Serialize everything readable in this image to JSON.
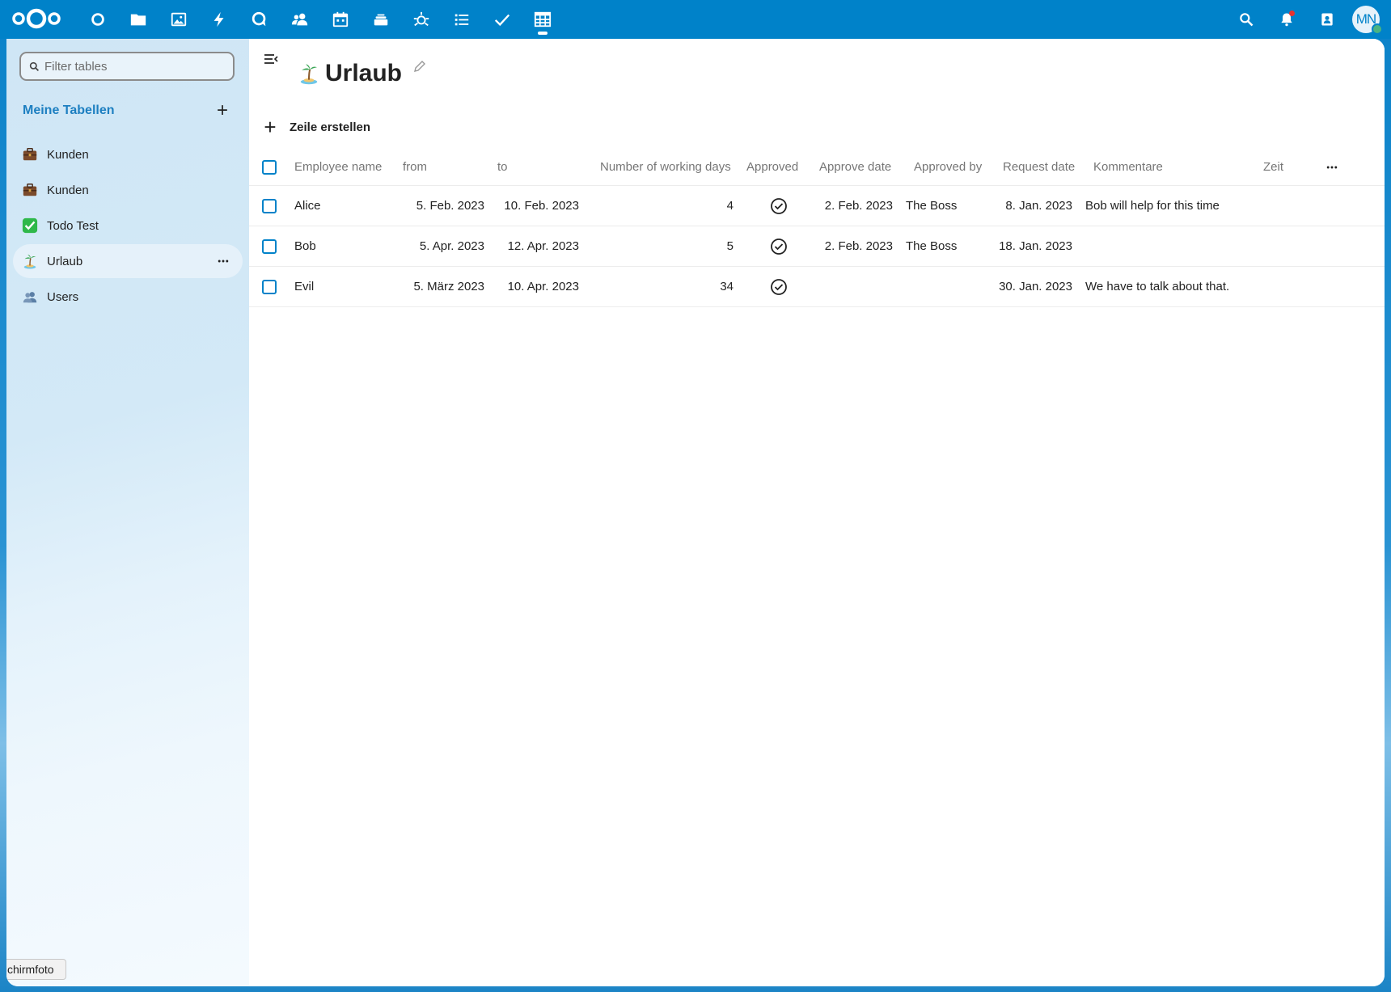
{
  "topbar": {
    "apps": [
      "dashboard-icon",
      "files-icon",
      "photos-icon",
      "activity-icon",
      "talk-icon",
      "contacts-icon",
      "calendar-icon",
      "deck-icon",
      "ai-icon",
      "tasks-list-icon",
      "checkmark-icon",
      "tables-icon"
    ],
    "avatar_initials": "MN"
  },
  "sidebar": {
    "filter_placeholder": "Filter tables",
    "section_title": "Meine Tabellen",
    "add_label": "+",
    "items": [
      {
        "emoji": "briefcase",
        "label": "Kunden"
      },
      {
        "emoji": "briefcase",
        "label": "Kunden"
      },
      {
        "emoji": "check-box",
        "label": "Todo Test"
      },
      {
        "emoji": "palm-island",
        "label": "Urlaub"
      },
      {
        "emoji": "users",
        "label": "Users"
      }
    ],
    "tooltip": "chirmfoto"
  },
  "main": {
    "title": "Urlaub",
    "create_label": "Zeile erstellen",
    "columns": {
      "name": "Employee name",
      "from": "from",
      "to": "to",
      "days": "Number of working days",
      "approved": "Approved",
      "approve_date": "Approve date",
      "approved_by": "Approved by",
      "request_date": "Request date",
      "kommentare": "Kommentare",
      "zeit": "Zeit"
    },
    "rows": [
      {
        "name": "Alice",
        "from": "5. Feb. 2023",
        "to": "10. Feb. 2023",
        "days": "4",
        "approved": true,
        "approve_date": "2. Feb. 2023",
        "approved_by": "The Boss",
        "request_date": "8. Jan. 2023",
        "kommentare": "Bob will help for this time",
        "zeit": ""
      },
      {
        "name": "Bob",
        "from": "5. Apr. 2023",
        "to": "12. Apr. 2023",
        "days": "5",
        "approved": true,
        "approve_date": "2. Feb. 2023",
        "approved_by": "The Boss",
        "request_date": "18. Jan. 2023",
        "kommentare": "",
        "zeit": ""
      },
      {
        "name": "Evil",
        "from": "5. März 2023",
        "to": "10. Apr. 2023",
        "days": "34",
        "approved": true,
        "approve_date": "",
        "approved_by": "",
        "request_date": "30. Jan. 2023",
        "kommentare": "We have to talk about that.",
        "zeit": ""
      }
    ]
  },
  "colors": {
    "header": "#0082c9",
    "accent": "#1d7fc1"
  }
}
